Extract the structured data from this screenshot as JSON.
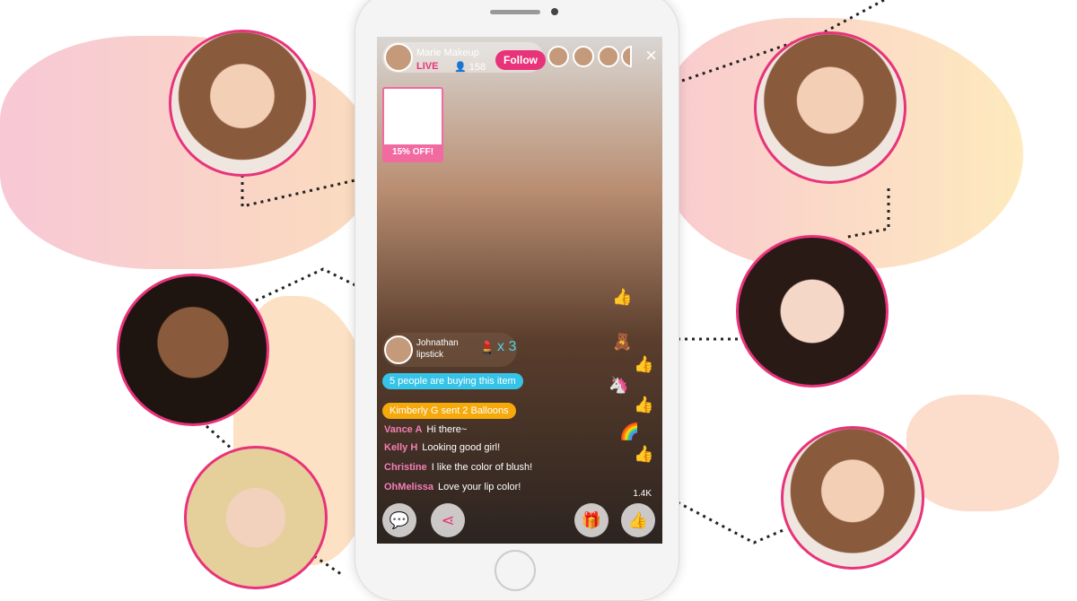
{
  "stream": {
    "host_name": "Marie Makeup",
    "live_label": "LIVE",
    "viewer_count": "158",
    "follow_label": "Follow",
    "close_icon": "×"
  },
  "promo": {
    "discount_label": "15% OFF!"
  },
  "gift": {
    "sender": "Johnathan",
    "item": "lipstick",
    "multiplier": "x 3"
  },
  "notices": [
    {
      "text": "5 people are buying this item",
      "color": "#35c3e8"
    },
    {
      "text": "Kimberly G sent 2 Balloons",
      "color": "#f5a90a"
    }
  ],
  "chat": [
    {
      "user": "Vance A",
      "message": "Hi there~"
    },
    {
      "user": "Kelly H",
      "message": "Looking good girl!"
    },
    {
      "user": "Christine",
      "message": "I like the color of blush!"
    },
    {
      "user": "OhMelissa",
      "message": "Love your lip color!"
    }
  ],
  "like_count": "1.4K",
  "colors": {
    "accent": "#e8337a",
    "cyan": "#35c3e8",
    "orange": "#f5a90a"
  }
}
